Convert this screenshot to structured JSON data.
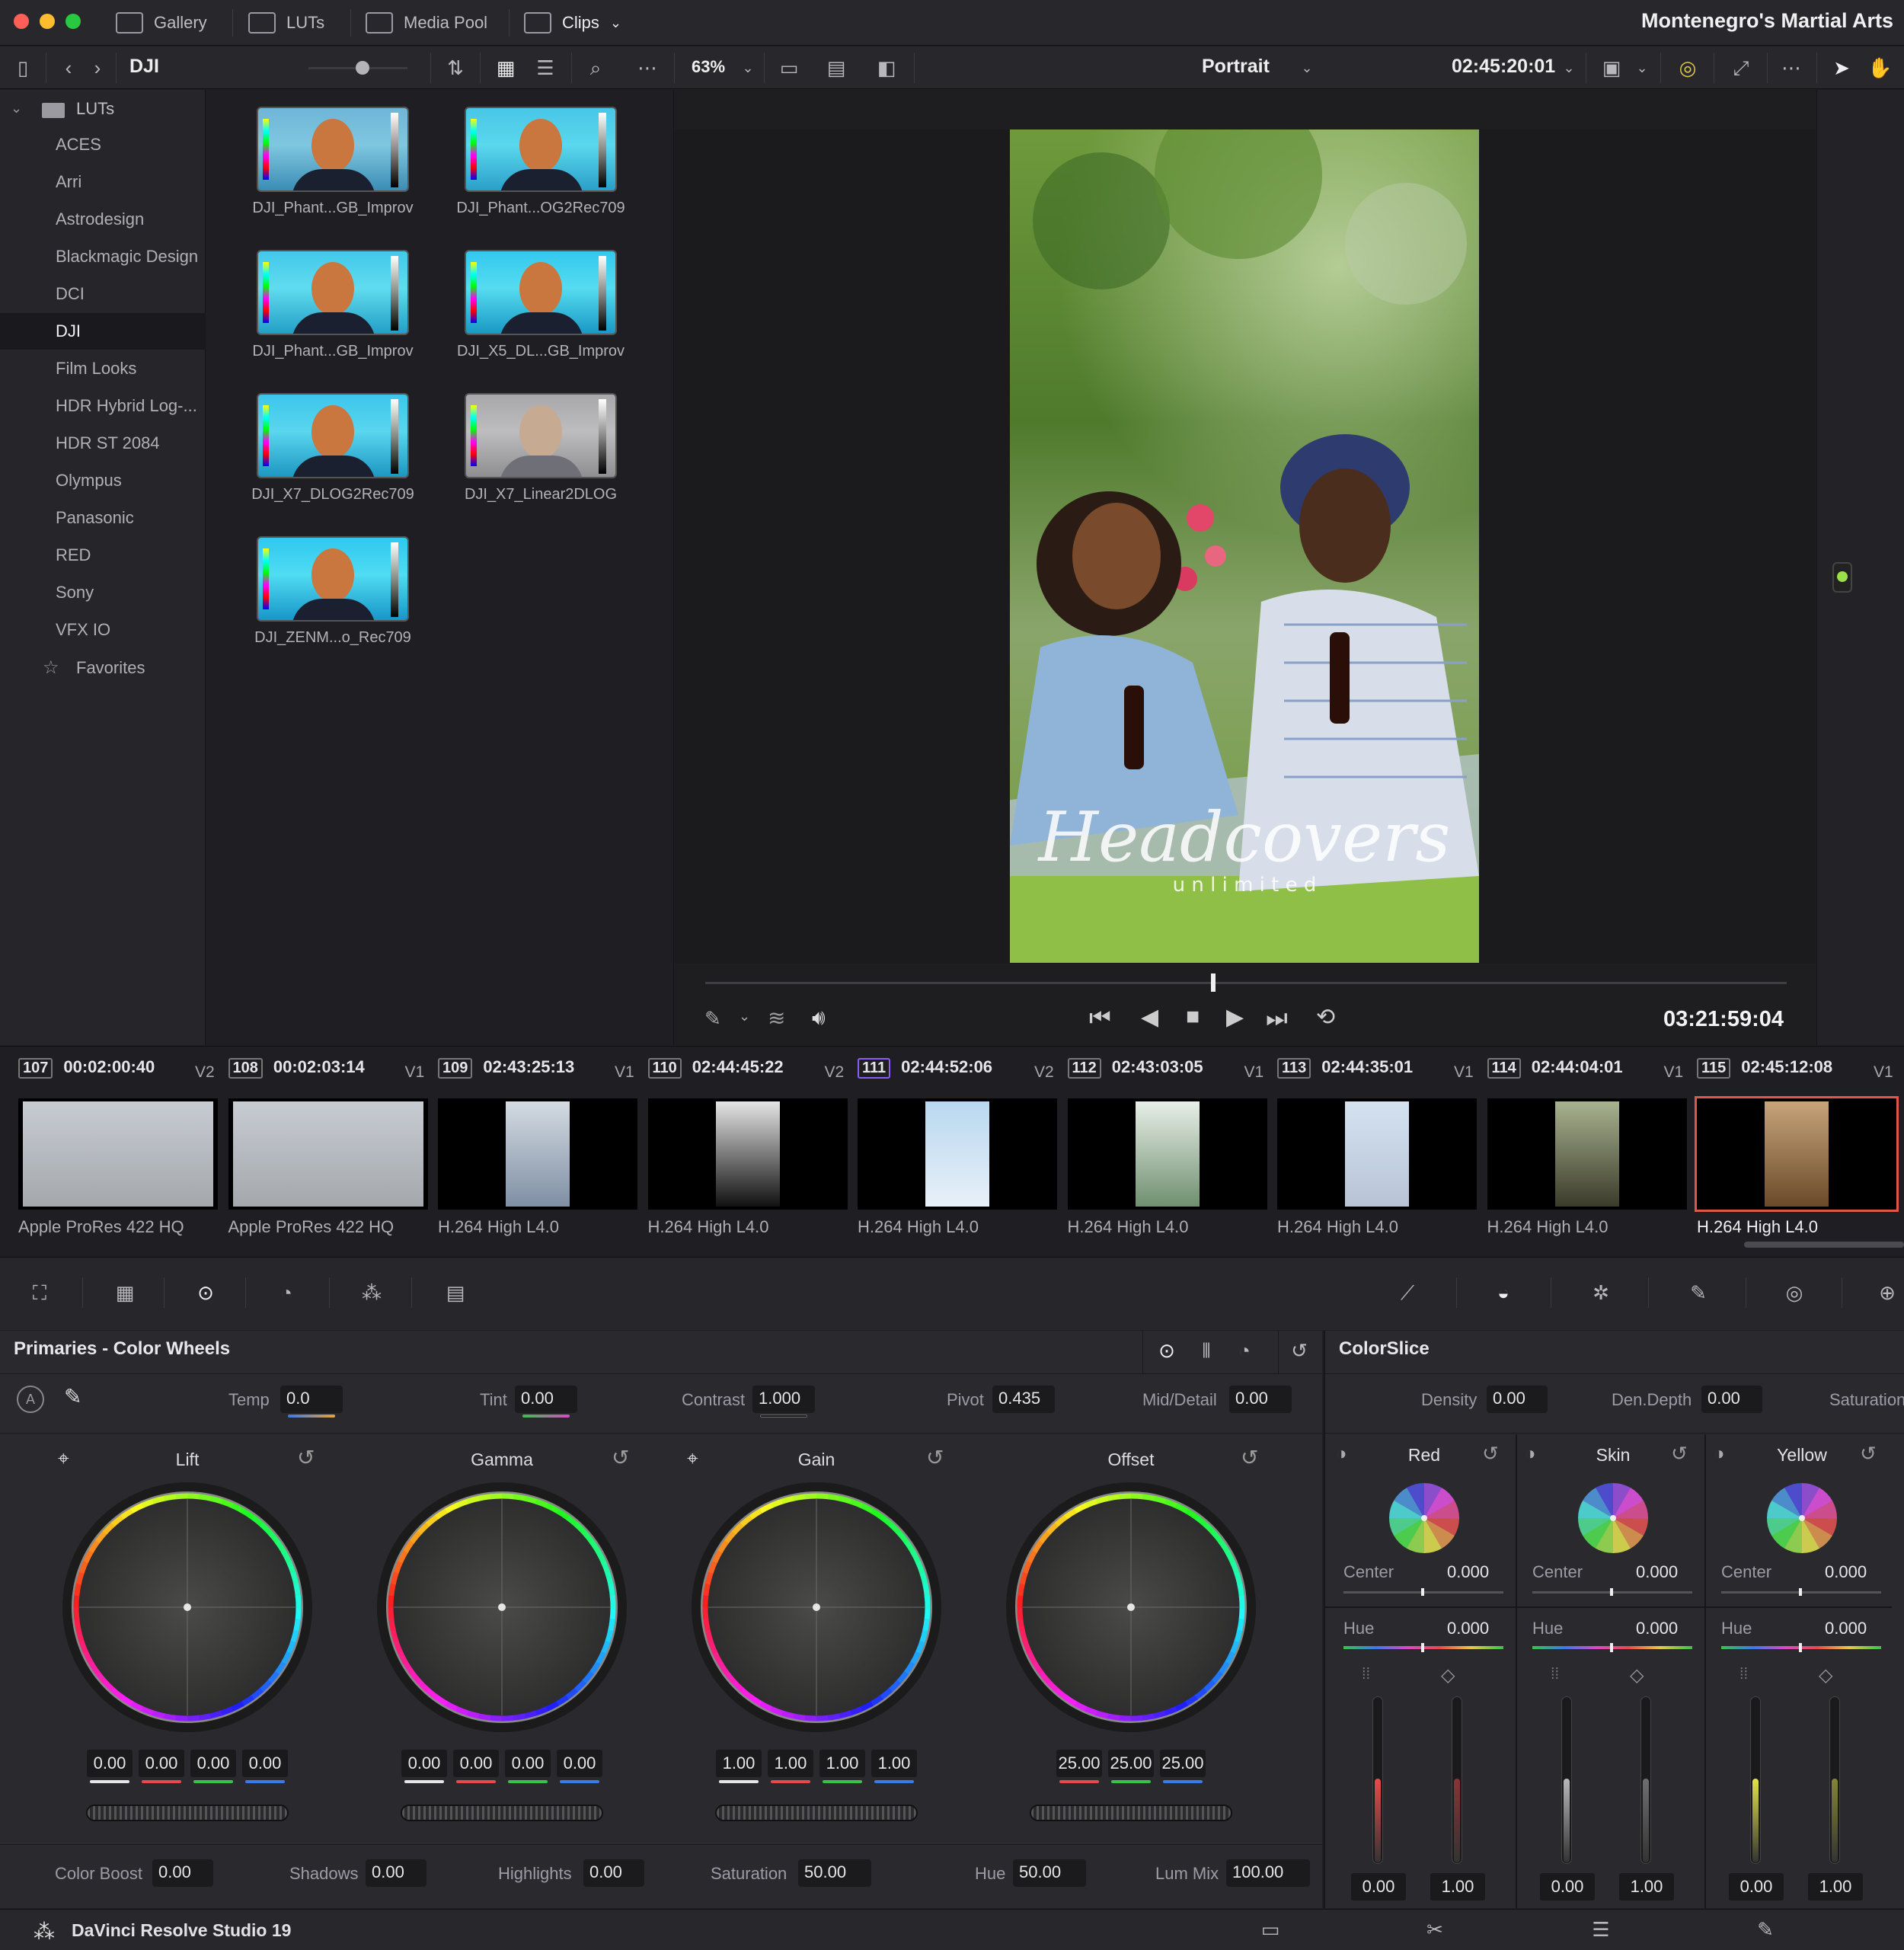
{
  "titlebar": {
    "tabs": [
      {
        "label": "Gallery",
        "icon": "gallery-icon"
      },
      {
        "label": "LUTs",
        "icon": "luts-icon"
      },
      {
        "label": "Media Pool",
        "icon": "media-pool-icon"
      },
      {
        "label": "Clips",
        "icon": "clips-icon"
      }
    ],
    "project_title": "Montenegro's Martial Arts"
  },
  "toolbar": {
    "folder": "DJI",
    "zoom": "63%",
    "view_mode": "Portrait",
    "timecode": "02:45:20:01"
  },
  "lut_sidebar": {
    "root": "LUTs",
    "items": [
      "ACES",
      "Arri",
      "Astrodesign",
      "Blackmagic Design",
      "DCI",
      "DJI",
      "Film Looks",
      "HDR Hybrid Log-...",
      "HDR ST 2084",
      "Olympus",
      "Panasonic",
      "RED",
      "Sony",
      "VFX IO"
    ],
    "active": "DJI",
    "favorites": "Favorites"
  },
  "lut_grid": [
    "DJI_Phant...GB_Improv",
    "DJI_Phant...OG2Rec709",
    "DJI_Phant...GB_Improv",
    "DJI_X5_DL...GB_Improv",
    "DJI_X7_DLOG2Rec709",
    "DJI_X7_Linear2DLOG",
    "DJI_ZENM...o_Rec709"
  ],
  "viewer": {
    "watermark_script": "Headcovers",
    "watermark_sub": "u n l i m i t e d",
    "playback_timecode": "03:21:59:04",
    "playhead_fraction": 0.47
  },
  "clips": [
    {
      "num": "107",
      "tc": "00:02:00:40",
      "track": "V2",
      "codec": "Apple ProRes 422 HQ"
    },
    {
      "num": "108",
      "tc": "00:02:03:14",
      "track": "V1",
      "codec": "Apple ProRes 422 HQ"
    },
    {
      "num": "109",
      "tc": "02:43:25:13",
      "track": "V1",
      "codec": "H.264 High L4.0"
    },
    {
      "num": "110",
      "tc": "02:44:45:22",
      "track": "V2",
      "codec": "H.264 High L4.0"
    },
    {
      "num": "111",
      "tc": "02:44:52:06",
      "track": "V2",
      "codec": "H.264 High L4.0"
    },
    {
      "num": "112",
      "tc": "02:43:03:05",
      "track": "V1",
      "codec": "H.264 High L4.0"
    },
    {
      "num": "113",
      "tc": "02:44:35:01",
      "track": "V1",
      "codec": "H.264 High L4.0"
    },
    {
      "num": "114",
      "tc": "02:44:04:01",
      "track": "V1",
      "codec": "H.264 High L4.0"
    },
    {
      "num": "115",
      "tc": "02:45:12:08",
      "track": "V1",
      "codec": "H.264 High L4.0"
    }
  ],
  "primaries": {
    "title": "Primaries - Color Wheels",
    "temp": {
      "label": "Temp",
      "value": "0.0"
    },
    "tint": {
      "label": "Tint",
      "value": "0.00"
    },
    "contrast": {
      "label": "Contrast",
      "value": "1.000"
    },
    "pivot": {
      "label": "Pivot",
      "value": "0.435"
    },
    "mid_detail": {
      "label": "Mid/Detail",
      "value": "0.00"
    },
    "wheels": [
      {
        "name": "Lift",
        "values": [
          "0.00",
          "0.00",
          "0.00",
          "0.00"
        ]
      },
      {
        "name": "Gamma",
        "values": [
          "0.00",
          "0.00",
          "0.00",
          "0.00"
        ]
      },
      {
        "name": "Gain",
        "values": [
          "1.00",
          "1.00",
          "1.00",
          "1.00"
        ]
      },
      {
        "name": "Offset",
        "values": [
          "25.00",
          "25.00",
          "25.00"
        ]
      }
    ],
    "color_boost": {
      "label": "Color Boost",
      "value": "0.00"
    },
    "shadows": {
      "label": "Shadows",
      "value": "0.00"
    },
    "highlights": {
      "label": "Highlights",
      "value": "0.00"
    },
    "saturation": {
      "label": "Saturation",
      "value": "50.00"
    },
    "hue": {
      "label": "Hue",
      "value": "50.00"
    },
    "lum_mix": {
      "label": "Lum Mix",
      "value": "100.00"
    }
  },
  "colorslice": {
    "title": "ColorSlice",
    "density": {
      "label": "Density",
      "value": "0.00"
    },
    "den_depth": {
      "label": "Den.Depth",
      "value": "0.00"
    },
    "saturation_label": "Saturation",
    "slices": [
      {
        "name": "Red",
        "center_label": "Center",
        "center": "0.000",
        "hue_label": "Hue",
        "hue": "0.000",
        "low": "0.00",
        "high": "1.00",
        "color": "#e84a4a"
      },
      {
        "name": "Skin",
        "center_label": "Center",
        "center": "0.000",
        "hue_label": "Hue",
        "hue": "0.000",
        "low": "0.00",
        "high": "1.00",
        "color": "#b9b9bc"
      },
      {
        "name": "Yellow",
        "center_label": "Center",
        "center": "0.000",
        "hue_label": "Hue",
        "hue": "0.000",
        "low": "0.00",
        "high": "1.00",
        "color": "#e3e34a"
      }
    ]
  },
  "footer": {
    "app_name": "DaVinci Resolve Studio 19"
  },
  "colors": {
    "accent_selected": "#e0574a",
    "active_clip_border": "#8b5cf6"
  }
}
